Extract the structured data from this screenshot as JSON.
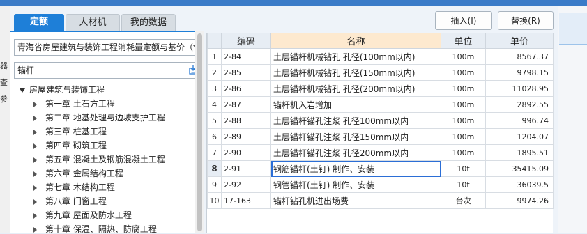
{
  "tabs": [
    "定额",
    "人材机",
    "我的数据"
  ],
  "buttons": {
    "insert": "插入(I)",
    "replace": "替换(R)"
  },
  "quota_library": "青海省房屋建筑与装饰工程消耗量定额与基价（",
  "search_value": "锚杆",
  "tree": {
    "root": "房屋建筑与装饰工程",
    "chapters": [
      "第一章  土石方工程",
      "第二章  地基处理与边坡支护工程",
      "第三章  桩基工程",
      "第四章  砌筑工程",
      "第五章  混凝土及钢筋混凝土工程",
      "第六章  金属结构工程",
      "第七章  木结构工程",
      "第八章  门窗工程",
      "第九章  屋面及防水工程",
      "第十章  保温、隔热、防腐工程"
    ]
  },
  "table": {
    "columns": [
      "编码",
      "名称",
      "单位",
      "单价"
    ],
    "rows": [
      {
        "no": "1",
        "code": "2-84",
        "name": "土层锚杆机械钻孔  孔径(100mm以内)",
        "unit": "100m",
        "price": "8567.37"
      },
      {
        "no": "2",
        "code": "2-85",
        "name": "土层锚杆机械钻孔  孔径(150mm以内)",
        "unit": "100m",
        "price": "9798.15"
      },
      {
        "no": "3",
        "code": "2-86",
        "name": "土层锚杆机械钻孔  孔径(200mm以内)",
        "unit": "100m",
        "price": "11028.95"
      },
      {
        "no": "4",
        "code": "2-87",
        "name": "锚杆机入岩增加",
        "unit": "100m",
        "price": "2892.55"
      },
      {
        "no": "5",
        "code": "2-88",
        "name": "土层锚杆锚孔注浆  孔径100mm以内",
        "unit": "100m",
        "price": "996.74"
      },
      {
        "no": "6",
        "code": "2-89",
        "name": "土层锚杆锚孔注浆  孔径150mm以内",
        "unit": "100m",
        "price": "1204.07"
      },
      {
        "no": "7",
        "code": "2-90",
        "name": "土层锚杆锚孔注浆  孔径200mm以内",
        "unit": "100m",
        "price": "1895.51"
      },
      {
        "no": "8",
        "code": "2-91",
        "name": "钢筋锚杆(土钉) 制作、安装",
        "unit": "10t",
        "price": "35415.09"
      },
      {
        "no": "9",
        "code": "2-92",
        "name": "钢管锚杆(土钉) 制作、安装",
        "unit": "10t",
        "price": "36039.5"
      },
      {
        "no": "10",
        "code": "17-163",
        "name": "锚杆钻孔机进出场费",
        "unit": "台次",
        "price": "9974.26"
      }
    ],
    "selected_row": "8"
  },
  "background": {
    "left_chars": [
      "器",
      "查",
      "参"
    ]
  },
  "colors": {
    "accent": "#1e7fd8",
    "header_highlight": "#fde9cf",
    "selection_outline": "#2b6ed6"
  }
}
